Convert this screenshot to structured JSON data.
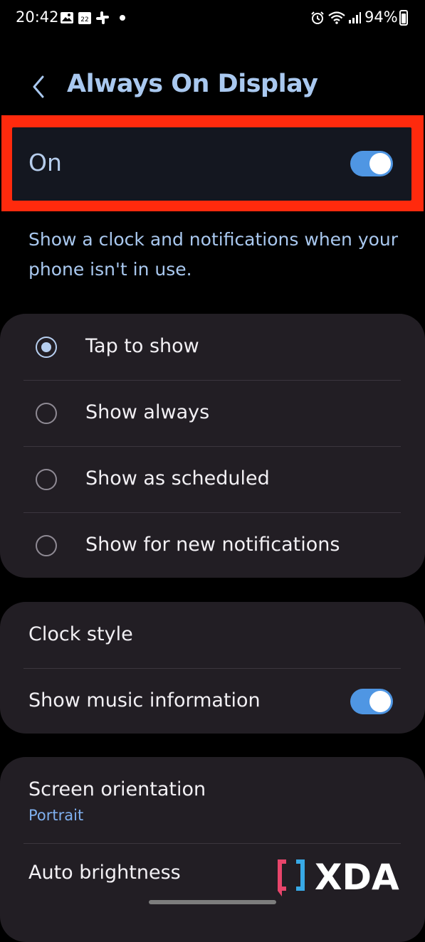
{
  "status_bar": {
    "time": "20:42",
    "calendar_day": "22",
    "battery": "94%",
    "icons": [
      "gallery-icon",
      "calendar-icon",
      "slack-icon",
      "alarm-icon",
      "wifi-icon",
      "signal-icon",
      "battery-icon"
    ]
  },
  "header": {
    "back_icon": "chevron-left-icon",
    "title": "Always On Display"
  },
  "master": {
    "label": "On",
    "enabled": true,
    "highlight_color": "#ff2a0d"
  },
  "description": "Show a clock and notifications when your phone isn't in use.",
  "display_mode": {
    "selected": "Tap to show",
    "options": [
      {
        "label": "Tap to show",
        "selected": true
      },
      {
        "label": "Show always",
        "selected": false
      },
      {
        "label": "Show as scheduled",
        "selected": false
      },
      {
        "label": "Show for new notifications",
        "selected": false
      }
    ]
  },
  "style_section": {
    "clock_style": "Clock style",
    "music_info": {
      "label": "Show music information",
      "enabled": true
    }
  },
  "more_section": {
    "screen_orientation": {
      "label": "Screen orientation",
      "value": "Portrait"
    },
    "auto_brightness": {
      "label": "Auto brightness"
    }
  },
  "watermark": {
    "brand": "XDA"
  },
  "colors": {
    "accent": "#4f96e3",
    "title": "#a9c8ef",
    "card": "#221e24",
    "background": "#000000"
  }
}
